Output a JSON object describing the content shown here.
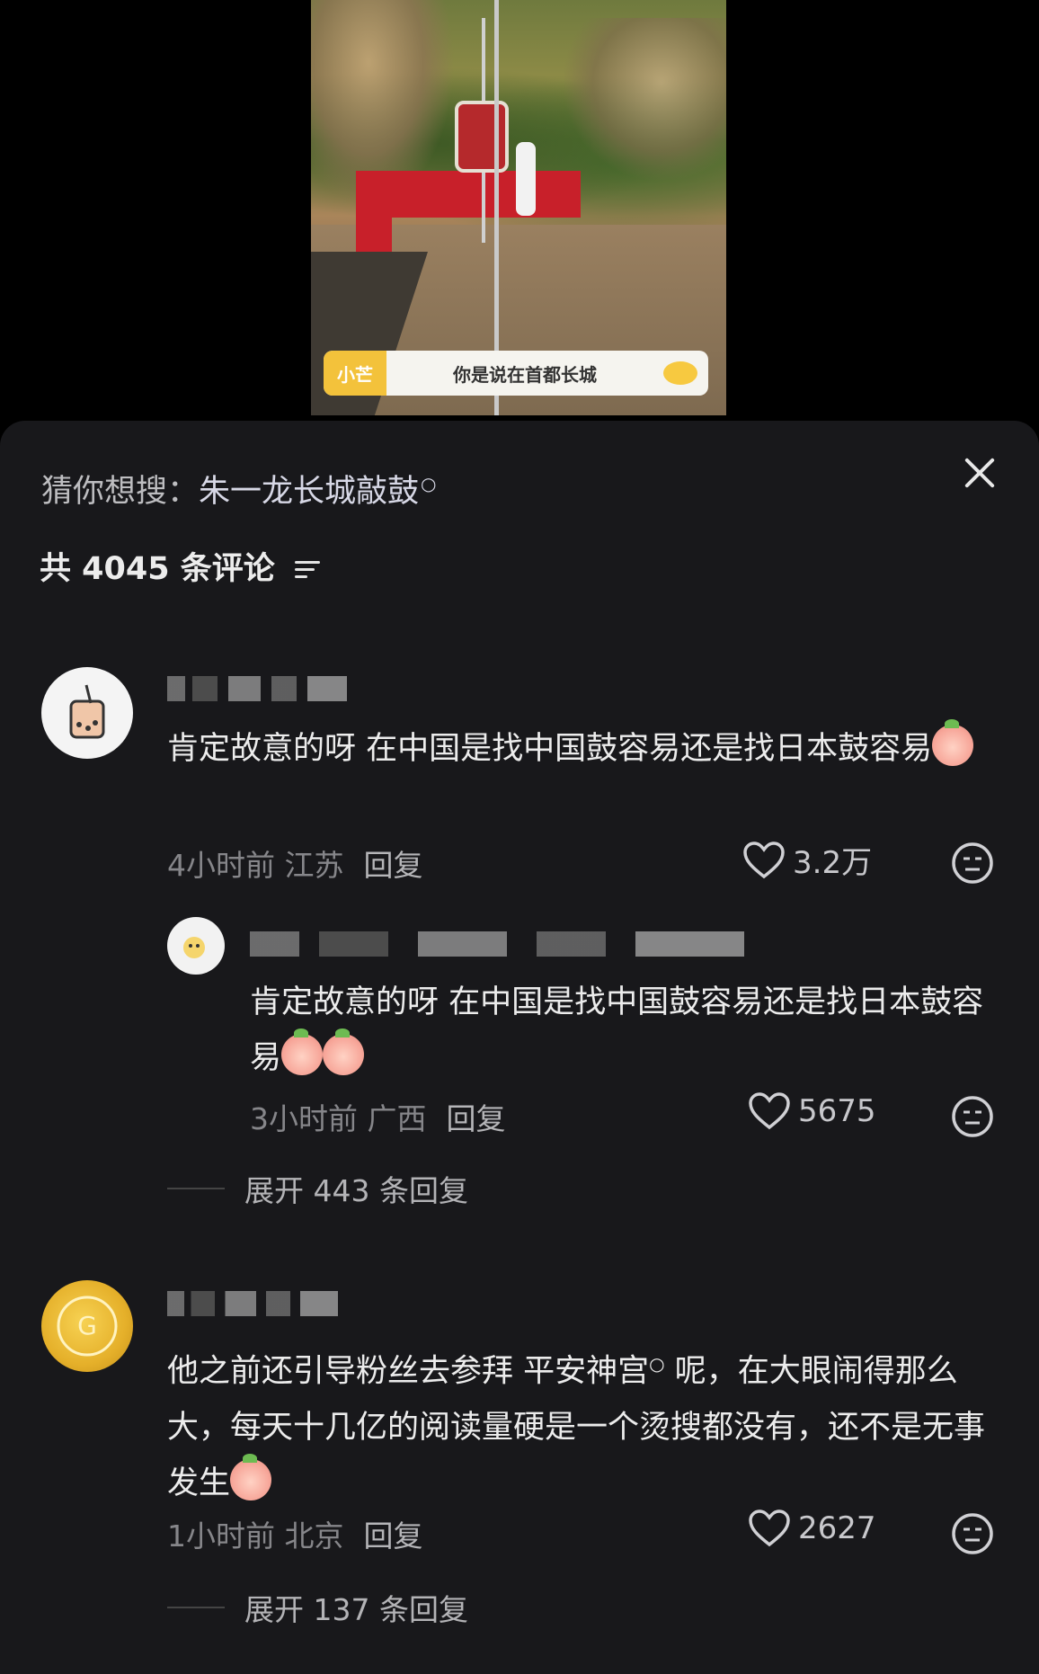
{
  "video": {
    "subtitle_tag": "小芒",
    "subtitle_text": "你是说在首都长城"
  },
  "header": {
    "suggest_prefix": "猜你想搜：",
    "suggest_keyword": "朱一龙长城敲鼓",
    "comment_count": "共 4045 条评论"
  },
  "comments": [
    {
      "text": "肯定故意的呀 在中国是找中国鼓容易还是找日本鼓容易",
      "time": "4小时前",
      "location": "江苏",
      "reply_label": "回复",
      "likes": "3.2万",
      "replies": [
        {
          "text": "肯定故意的呀 在中国是找中国鼓容易还是找日本鼓容易",
          "time": "3小时前",
          "location": "广西",
          "reply_label": "回复",
          "likes": "5675"
        }
      ],
      "expand_label": "展开 443 条回复"
    },
    {
      "text_part1": "他之前还引导粉丝去参拜 ",
      "search_term": "平安神宫",
      "text_part2": " 呢，在大眼闹得那么大，每天十几亿的阅读量硬是一个烫搜都没有，还不是无事发生",
      "time": "1小时前",
      "location": "北京",
      "reply_label": "回复",
      "likes": "2627",
      "expand_label": "展开 137 条回复"
    }
  ]
}
